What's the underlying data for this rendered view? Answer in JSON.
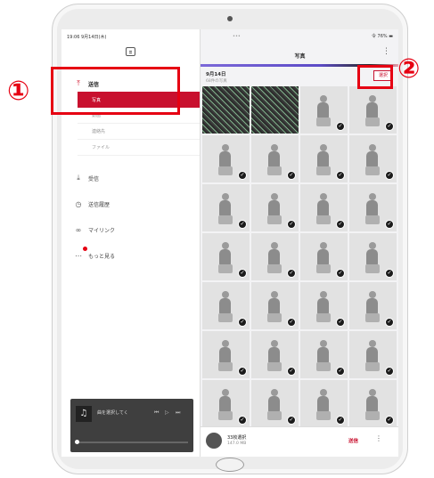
{
  "sidebar": {
    "status_time": "19:06  9月14日(木)",
    "menu_send": "送信",
    "submenu": [
      "写真",
      "動画",
      "連絡先",
      "ファイル"
    ],
    "menu_receive": "受信",
    "menu_history": "送信履歴",
    "menu_mylink": "マイリンク",
    "menu_more": "もっと見る",
    "player_title": "曲を選択してく",
    "icons": {
      "compose": "compose-icon",
      "send": "upload-icon",
      "receive": "download-icon",
      "history": "clock-icon",
      "mylink": "link-icon",
      "more": "more-dots-icon",
      "music": "music-note-icon"
    }
  },
  "panel": {
    "status_dots": "•••",
    "status_battery": "令 76% ▬",
    "title": "写真",
    "more_icon": "⋮",
    "section_date": "9月14日",
    "section_sub": "68件の写真",
    "select_label": "選択",
    "photos": [
      {
        "style": "green",
        "checked": false
      },
      {
        "style": "green",
        "checked": false
      },
      {
        "style": "bw",
        "checked": true
      },
      {
        "style": "bw",
        "checked": true
      },
      {
        "style": "bw",
        "checked": true
      },
      {
        "style": "bw",
        "checked": true
      },
      {
        "style": "bw",
        "checked": true
      },
      {
        "style": "bw",
        "checked": true
      },
      {
        "style": "bw",
        "checked": true
      },
      {
        "style": "bw",
        "checked": true
      },
      {
        "style": "bw",
        "checked": true
      },
      {
        "style": "bw",
        "checked": true
      },
      {
        "style": "bw",
        "checked": true
      },
      {
        "style": "bw",
        "checked": true
      },
      {
        "style": "bw",
        "checked": true
      },
      {
        "style": "bw",
        "checked": true
      },
      {
        "style": "bw",
        "checked": true
      },
      {
        "style": "bw",
        "checked": true
      },
      {
        "style": "bw",
        "checked": true
      },
      {
        "style": "bw",
        "checked": true
      },
      {
        "style": "bw",
        "checked": true
      },
      {
        "style": "bw",
        "checked": true
      },
      {
        "style": "bw",
        "checked": true
      },
      {
        "style": "bw",
        "checked": true
      },
      {
        "style": "bw",
        "checked": true
      },
      {
        "style": "bw",
        "checked": true
      },
      {
        "style": "bw",
        "checked": true
      },
      {
        "style": "bw",
        "checked": true
      },
      {
        "style": "bw",
        "checked": true
      },
      {
        "style": "bw",
        "checked": true
      },
      {
        "style": "bw",
        "checked": true
      },
      {
        "style": "bw",
        "checked": true
      }
    ],
    "bottom_count": "33枚選択",
    "bottom_size": "147.0 MB",
    "bottom_send": "送信",
    "bottom_more": "⋮"
  },
  "annotations": {
    "label_1": "①",
    "label_2": "②"
  },
  "colors": {
    "accent": "#c8102e",
    "annotation": "#e60012"
  }
}
